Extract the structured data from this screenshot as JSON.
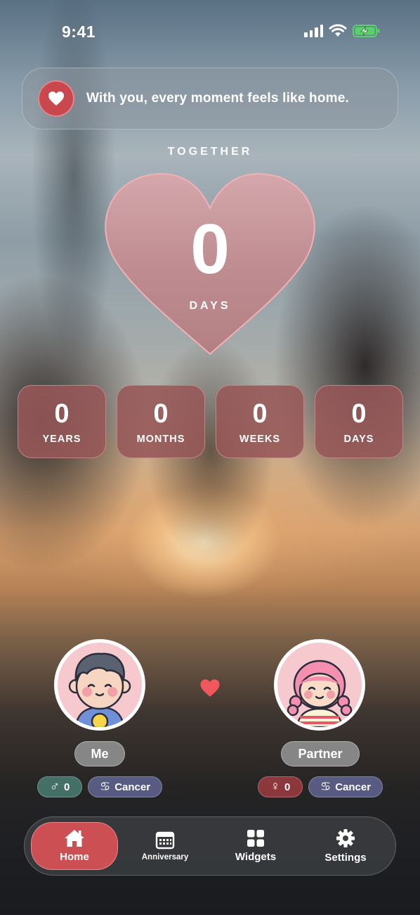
{
  "status_bar": {
    "time": "9:41"
  },
  "quote": {
    "text": "With you, every moment feels like home.",
    "icon": "heart-icon"
  },
  "counter": {
    "heading": "TOGETHER",
    "days_total": "0",
    "days_unit": "DAYS",
    "breakdown": [
      {
        "value": "0",
        "label": "YEARS"
      },
      {
        "value": "0",
        "label": "MONTHS"
      },
      {
        "value": "0",
        "label": "WEEKS"
      },
      {
        "value": "0",
        "label": "DAYS"
      }
    ]
  },
  "people": {
    "me": {
      "name": "Me",
      "gender_symbol": "♂",
      "count": "0",
      "zodiac_symbol": "♋",
      "zodiac": "Cancer"
    },
    "partner": {
      "name": "Partner",
      "gender_symbol": "♀",
      "count": "0",
      "zodiac_symbol": "♋",
      "zodiac": "Cancer"
    }
  },
  "tabs": [
    {
      "label": "Home",
      "icon": "home-icon",
      "active": true
    },
    {
      "label": "Anniversary",
      "icon": "calendar-icon",
      "active": false
    },
    {
      "label": "Widgets",
      "icon": "widgets-icon",
      "active": false
    },
    {
      "label": "Settings",
      "icon": "gear-icon",
      "active": false
    }
  ],
  "colors": {
    "accent": "#cc4f54",
    "heart": "#f0585e"
  }
}
